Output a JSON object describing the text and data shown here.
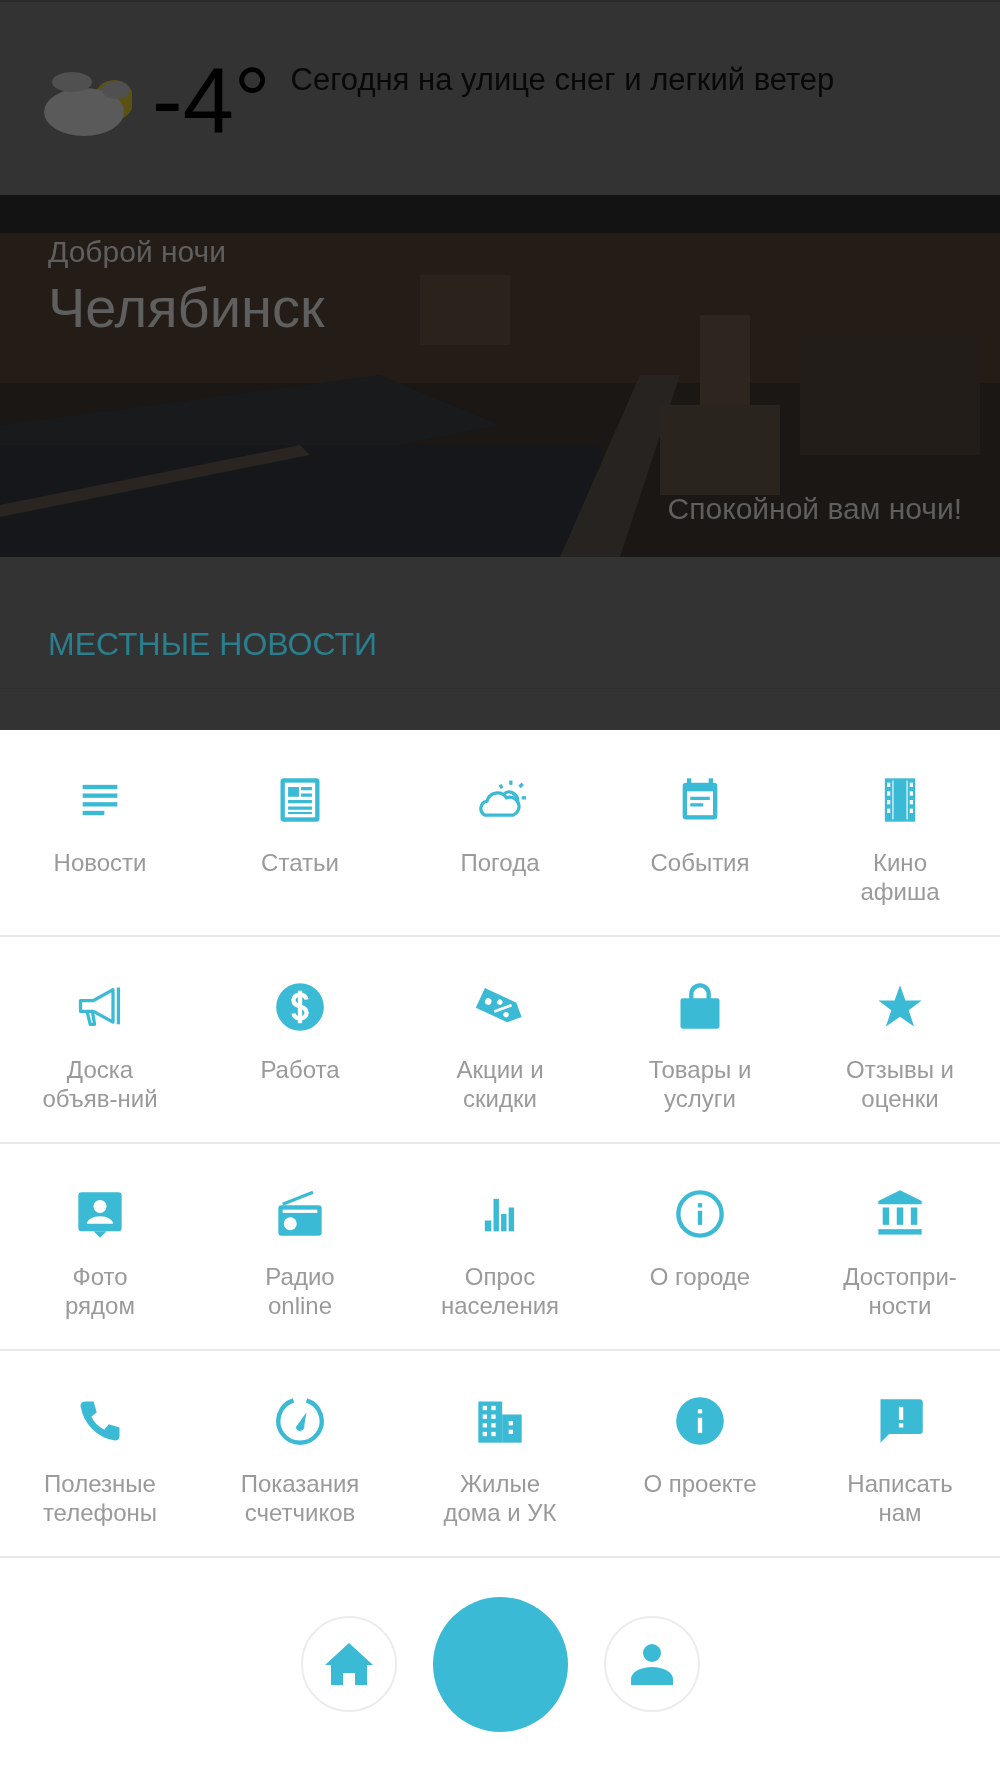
{
  "weather": {
    "temperature": "-4°",
    "description": "Сегодня на улице снег и легкий ветер"
  },
  "banner": {
    "greeting": "Доброй ночи",
    "city": "Челябинск",
    "wish": "Спокойной вам ночи!"
  },
  "news": {
    "heading": "МЕСТНЫЕ НОВОСТИ"
  },
  "menu": [
    [
      {
        "label": "Новости"
      },
      {
        "label": "Статьи"
      },
      {
        "label": "Погода"
      },
      {
        "label": "События"
      },
      {
        "label": "Кино\nафиша"
      }
    ],
    [
      {
        "label": "Доска\nобъяв-ний"
      },
      {
        "label": "Работа"
      },
      {
        "label": "Акции и\nскидки"
      },
      {
        "label": "Товары и\nуслуги"
      },
      {
        "label": "Отзывы и\nоценки"
      }
    ],
    [
      {
        "label": "Фото\nрядом"
      },
      {
        "label": "Радио\nonline"
      },
      {
        "label": "Опрос\nнаселения"
      },
      {
        "label": "О городе"
      },
      {
        "label": "Достопри-\nности"
      }
    ],
    [
      {
        "label": "Полезные\nтелефоны"
      },
      {
        "label": "Показания\nсчетчиков"
      },
      {
        "label": "Жилые\nдома и УК"
      },
      {
        "label": "О проекте"
      },
      {
        "label": "Написать\nнам"
      }
    ]
  ],
  "bottom_bar": [
    {
      "kind": "home"
    },
    {
      "kind": "center"
    },
    {
      "kind": "profile"
    }
  ]
}
